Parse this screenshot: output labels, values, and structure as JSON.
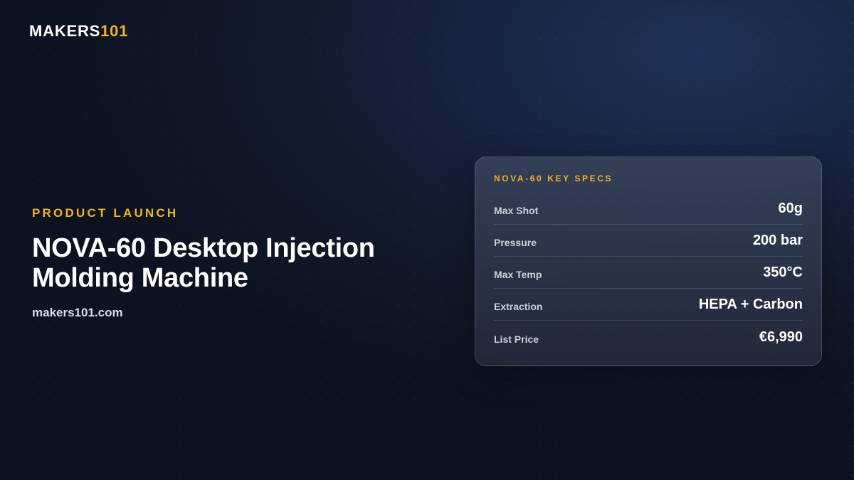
{
  "brand": {
    "word": "MAKERS",
    "accent": "101"
  },
  "hero": {
    "eyebrow": "PRODUCT LAUNCH",
    "title_line1": "NOVA-60 Desktop Injection",
    "title_line2": "Molding Machine",
    "url": "makers101.com"
  },
  "specs": {
    "title": "NOVA-60 KEY SPECS",
    "rows": [
      {
        "label": "Max Shot",
        "value": "60g"
      },
      {
        "label": "Pressure",
        "value": "200 bar"
      },
      {
        "label": "Max Temp",
        "value": "350°C"
      },
      {
        "label": "Extraction",
        "value": "HEPA + Carbon"
      },
      {
        "label": "List Price",
        "value": "€6,990"
      }
    ]
  },
  "colors": {
    "accent": "#f4b41a",
    "background": "#111a2b",
    "card": "#2e3748"
  }
}
